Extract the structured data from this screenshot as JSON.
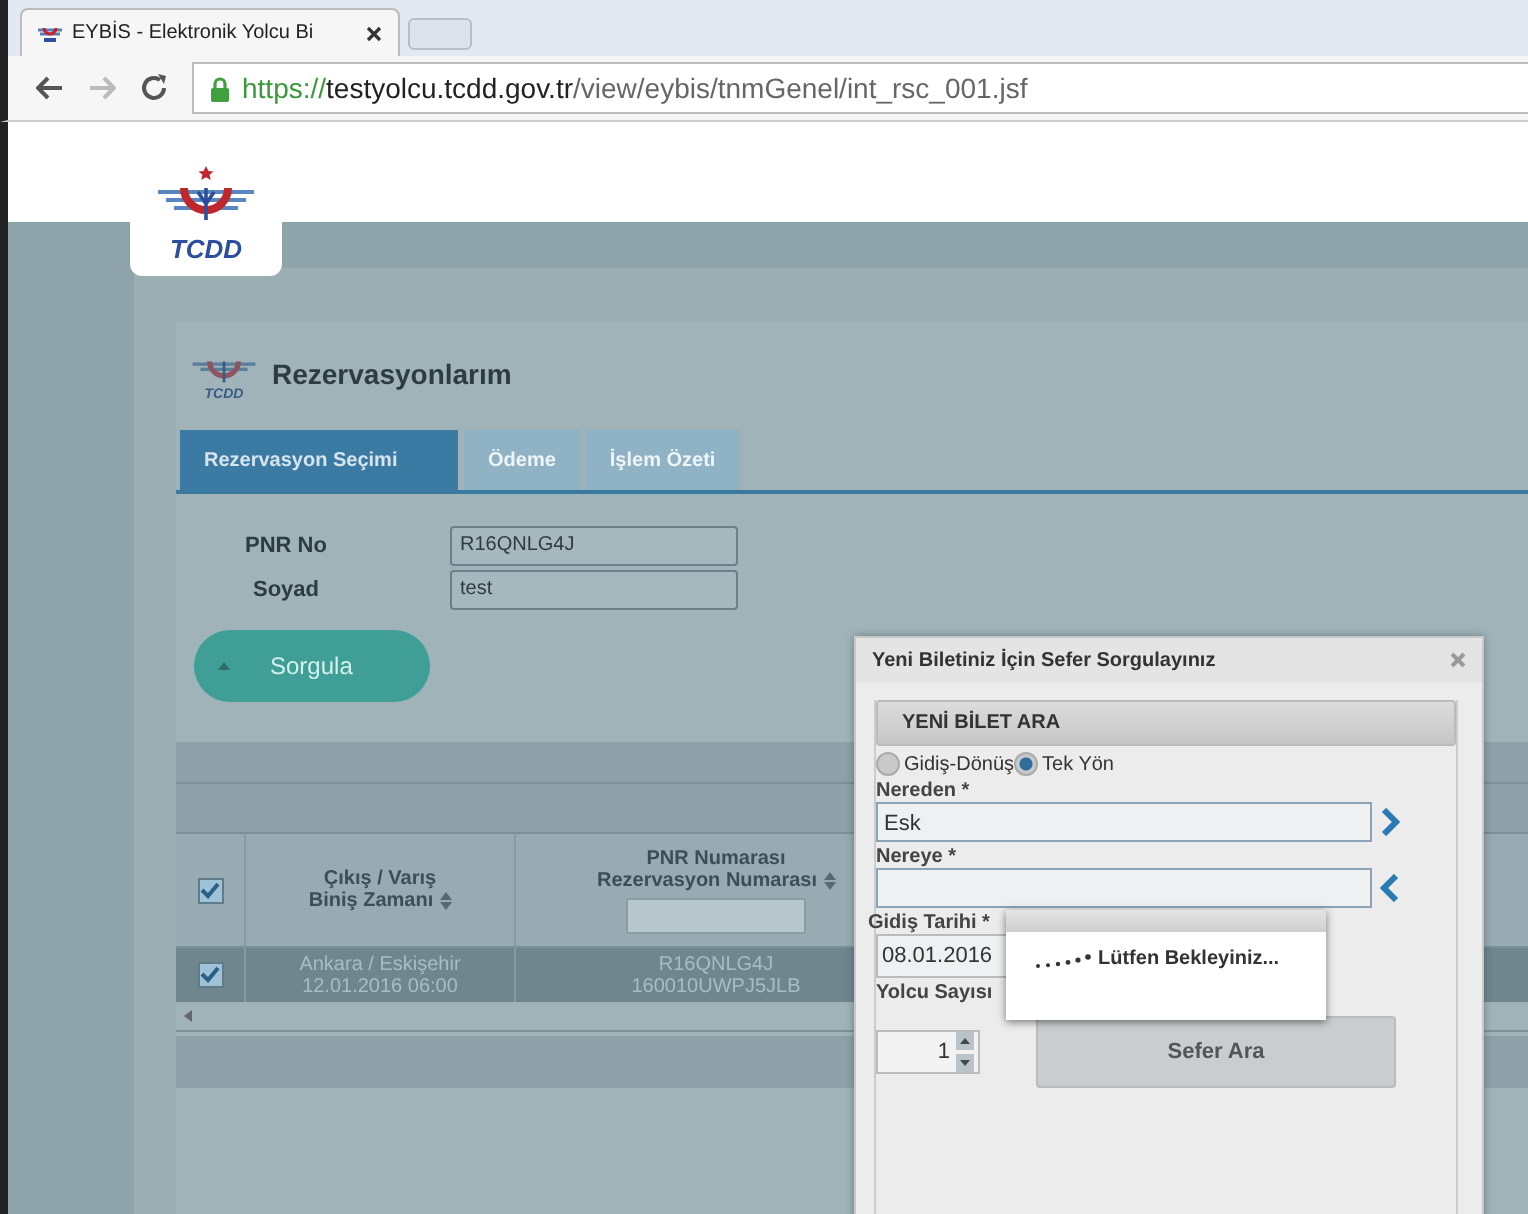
{
  "browser": {
    "tab_title": "EYBİS - Elektronik Yolcu Bi",
    "url_scheme": "https://",
    "url_host": "testyolcu.tcdd.gov.tr",
    "url_path": "/view/eybis/tnmGenel/int_rsc_001.jsf"
  },
  "header": {
    "logo_text": "TCDD"
  },
  "panel": {
    "logo_text": "TCDD",
    "title": "Rezervasyonlarım",
    "tabs": [
      {
        "label": "Rezervasyon Seçimi",
        "selected": true
      },
      {
        "label": "Ödeme",
        "selected": false
      },
      {
        "label": "İşlem Özeti",
        "selected": false
      }
    ],
    "fields": [
      {
        "label": "PNR No",
        "value": "R16QNLG4J"
      },
      {
        "label": "Soyad",
        "value": "test"
      }
    ],
    "query_button": "Sorgula",
    "table": {
      "header_checked": true,
      "columns": [
        {
          "lines": [
            "Çıkış / Varış",
            "Biniş Zamanı"
          ],
          "filter": false
        },
        {
          "lines": [
            "PNR Numarası",
            "Rezervasyon Numarası"
          ],
          "filter": true
        }
      ],
      "rows": [
        {
          "selected": true,
          "cells": [
            [
              "Ankara / Eskişehir",
              "12.01.2016 06:00"
            ],
            [
              "R16QNLG4J",
              "160010UWPJ5JLB"
            ]
          ]
        }
      ]
    }
  },
  "dialog": {
    "title": "Yeni Biletiniz İçin Sefer Sorgulayınız",
    "section": "YENİ BİLET ARA",
    "trip_types": [
      {
        "label": "Gidiş-Dönüş",
        "selected": false
      },
      {
        "label": "Tek Yön",
        "selected": true
      }
    ],
    "from": {
      "label": "Nereden *",
      "value": "Esk"
    },
    "to": {
      "label": "Nereye *"
    },
    "date": {
      "label": "Gidiş Tarihi *",
      "value": "08.01.2016"
    },
    "passengers": {
      "label": "Yolcu Sayısı",
      "value": "1"
    },
    "search_button": "Sefer Ara"
  },
  "loading": {
    "text": "Lütfen Bekleyiniz..."
  }
}
